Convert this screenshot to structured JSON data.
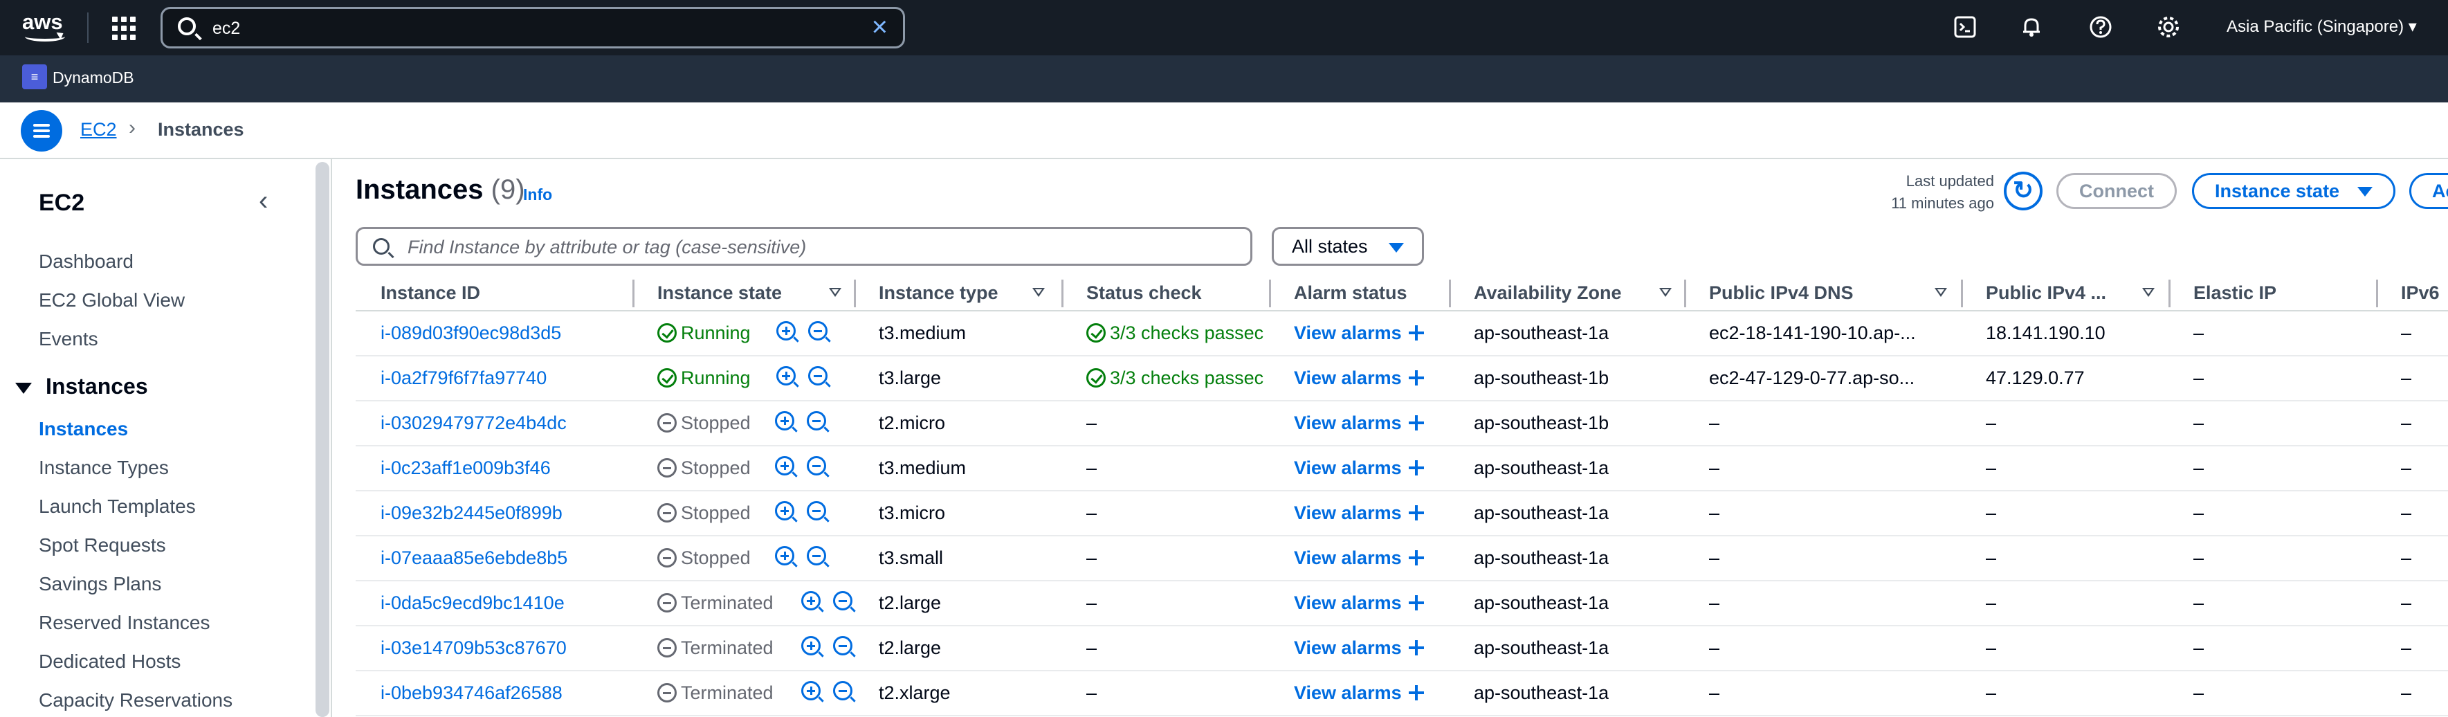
{
  "topbar": {
    "logo_text": "aws",
    "search_value": "ec2",
    "region": "Asia Pacific (Singapore)",
    "icons": [
      "cloudshell-icon",
      "bell-icon",
      "help-icon",
      "gear-icon"
    ]
  },
  "favorites": {
    "dynamodb_label": "DynamoDB"
  },
  "breadcrumb": {
    "root": "EC2",
    "current": "Instances"
  },
  "sidebar": {
    "title": "EC2",
    "top_items": [
      "Dashboard",
      "EC2 Global View",
      "Events"
    ],
    "section": "Instances",
    "section_items": [
      "Instances",
      "Instance Types",
      "Launch Templates",
      "Spot Requests",
      "Savings Plans",
      "Reserved Instances",
      "Dedicated Hosts",
      "Capacity Reservations"
    ]
  },
  "header": {
    "title": "Instances",
    "count": "(9)",
    "info": "Info",
    "last_updated_label": "Last updated",
    "last_updated_value": "11 minutes ago",
    "connect": "Connect",
    "instance_state": "Instance state",
    "actions": "Ac"
  },
  "filter": {
    "placeholder": "Find Instance by attribute or tag (case-sensitive)",
    "states": "All states"
  },
  "columns": [
    "Instance ID",
    "Instance state",
    "Instance type",
    "Status check",
    "Alarm status",
    "Availability Zone",
    "Public IPv4 DNS",
    "Public IPv4 ...",
    "Elastic IP",
    "IPv6"
  ],
  "rows": [
    {
      "id": "i-089d03f90ec98d3d5",
      "state": "Running",
      "type": "t3.medium",
      "check": "3/3 checks passec",
      "alarm": "View alarms",
      "az": "ap-southeast-1a",
      "dns": "ec2-18-141-190-10.ap-...",
      "ip": "18.141.190.10",
      "eip": "–",
      "ipv6": "–"
    },
    {
      "id": "i-0a2f79f6f7fa97740",
      "state": "Running",
      "type": "t3.large",
      "check": "3/3 checks passec",
      "alarm": "View alarms",
      "az": "ap-southeast-1b",
      "dns": "ec2-47-129-0-77.ap-so...",
      "ip": "47.129.0.77",
      "eip": "–",
      "ipv6": "–"
    },
    {
      "id": "i-03029479772e4b4dc",
      "state": "Stopped",
      "type": "t2.micro",
      "check": "–",
      "alarm": "View alarms",
      "az": "ap-southeast-1b",
      "dns": "–",
      "ip": "–",
      "eip": "–",
      "ipv6": "–"
    },
    {
      "id": "i-0c23aff1e009b3f46",
      "state": "Stopped",
      "type": "t3.medium",
      "check": "–",
      "alarm": "View alarms",
      "az": "ap-southeast-1a",
      "dns": "–",
      "ip": "–",
      "eip": "–",
      "ipv6": "–"
    },
    {
      "id": "i-09e32b2445e0f899b",
      "state": "Stopped",
      "type": "t3.micro",
      "check": "–",
      "alarm": "View alarms",
      "az": "ap-southeast-1a",
      "dns": "–",
      "ip": "–",
      "eip": "–",
      "ipv6": "–"
    },
    {
      "id": "i-07eaaa85e6ebde8b5",
      "state": "Stopped",
      "type": "t3.small",
      "check": "–",
      "alarm": "View alarms",
      "az": "ap-southeast-1a",
      "dns": "–",
      "ip": "–",
      "eip": "–",
      "ipv6": "–"
    },
    {
      "id": "i-0da5c9ecd9bc1410e",
      "state": "Terminated",
      "type": "t2.large",
      "check": "–",
      "alarm": "View alarms",
      "az": "ap-southeast-1a",
      "dns": "–",
      "ip": "–",
      "eip": "–",
      "ipv6": "–"
    },
    {
      "id": "i-03e14709b53c87670",
      "state": "Terminated",
      "type": "t2.large",
      "check": "–",
      "alarm": "View alarms",
      "az": "ap-southeast-1a",
      "dns": "–",
      "ip": "–",
      "eip": "–",
      "ipv6": "–"
    },
    {
      "id": "i-0beb934746af26588",
      "state": "Terminated",
      "type": "t2.xlarge",
      "check": "–",
      "alarm": "View alarms",
      "az": "ap-southeast-1a",
      "dns": "–",
      "ip": "–",
      "eip": "–",
      "ipv6": "–"
    }
  ],
  "colors": {
    "link": "#006ce0",
    "running": "#037f0c",
    "muted": "#656871",
    "topbar": "#161d26",
    "subbar": "#232f3e"
  }
}
